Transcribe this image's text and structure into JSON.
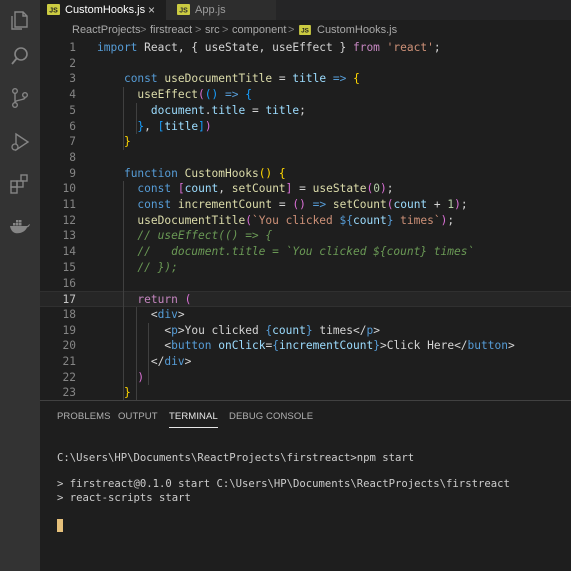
{
  "activity_bar": {
    "icons": [
      "explorer-icon",
      "search-icon",
      "source-control-icon",
      "run-debug-icon",
      "extensions-icon",
      "docker-icon"
    ]
  },
  "tabs": [
    {
      "label": "CustomHooks.js",
      "active": true,
      "icon": "js-file-icon",
      "close": "×"
    },
    {
      "label": "App.js",
      "active": false,
      "icon": "js-file-icon"
    }
  ],
  "breadcrumb": [
    "ReactProjects",
    "firstreact",
    "src",
    "component",
    "CustomHooks.js"
  ],
  "breadcrumb_separator": ">",
  "editor": {
    "current_line": 17,
    "lines": [
      {
        "n": "1",
        "tokens": [
          [
            "kw",
            "import"
          ],
          [
            "txt",
            " React, { useState, useEffect } "
          ],
          [
            "ctl",
            "from"
          ],
          [
            "txt",
            " "
          ],
          [
            "str",
            "'react'"
          ],
          [
            "txt",
            ";"
          ]
        ]
      },
      {
        "n": "2",
        "tokens": []
      },
      {
        "n": "3",
        "tokens": [
          [
            "txt",
            "    "
          ],
          [
            "kw",
            "const"
          ],
          [
            "txt",
            " "
          ],
          [
            "fn",
            "useDocumentTitle"
          ],
          [
            "txt",
            " = "
          ],
          [
            "var",
            "title"
          ],
          [
            "txt",
            " "
          ],
          [
            "kw",
            "=>"
          ],
          [
            "txt",
            " "
          ],
          [
            "b1",
            "{"
          ]
        ]
      },
      {
        "n": "4",
        "tokens": [
          [
            "txt",
            "      "
          ],
          [
            "fn",
            "useEffect"
          ],
          [
            "b2",
            "("
          ],
          [
            "b3",
            "()"
          ],
          [
            "txt",
            " "
          ],
          [
            "kw",
            "=>"
          ],
          [
            "txt",
            " "
          ],
          [
            "b3",
            "{"
          ]
        ]
      },
      {
        "n": "5",
        "tokens": [
          [
            "txt",
            "        "
          ],
          [
            "var",
            "document"
          ],
          [
            "txt",
            "."
          ],
          [
            "var",
            "title"
          ],
          [
            "txt",
            " = "
          ],
          [
            "var",
            "title"
          ],
          [
            "txt",
            ";"
          ]
        ]
      },
      {
        "n": "6",
        "tokens": [
          [
            "txt",
            "      "
          ],
          [
            "b3",
            "}"
          ],
          [
            "txt",
            ", "
          ],
          [
            "b3",
            "["
          ],
          [
            "var",
            "title"
          ],
          [
            "b3",
            "]"
          ],
          [
            "b2",
            ")"
          ]
        ]
      },
      {
        "n": "7",
        "tokens": [
          [
            "txt",
            "    "
          ],
          [
            "b1",
            "}"
          ]
        ]
      },
      {
        "n": "8",
        "tokens": []
      },
      {
        "n": "9",
        "tokens": [
          [
            "txt",
            "    "
          ],
          [
            "kw",
            "function"
          ],
          [
            "txt",
            " "
          ],
          [
            "fn",
            "CustomHooks"
          ],
          [
            "b1",
            "()"
          ],
          [
            "txt",
            " "
          ],
          [
            "b1",
            "{"
          ]
        ]
      },
      {
        "n": "10",
        "tokens": [
          [
            "txt",
            "      "
          ],
          [
            "kw",
            "const"
          ],
          [
            "txt",
            " "
          ],
          [
            "b2",
            "["
          ],
          [
            "var",
            "count"
          ],
          [
            "txt",
            ", "
          ],
          [
            "fn",
            "setCount"
          ],
          [
            "b2",
            "]"
          ],
          [
            "txt",
            " = "
          ],
          [
            "fn",
            "useState"
          ],
          [
            "b2",
            "("
          ],
          [
            "num",
            "0"
          ],
          [
            "b2",
            ")"
          ],
          [
            "txt",
            ";"
          ]
        ]
      },
      {
        "n": "11",
        "tokens": [
          [
            "txt",
            "      "
          ],
          [
            "kw",
            "const"
          ],
          [
            "txt",
            " "
          ],
          [
            "fn",
            "incrementCount"
          ],
          [
            "txt",
            " = "
          ],
          [
            "b2",
            "()"
          ],
          [
            "txt",
            " "
          ],
          [
            "kw",
            "=>"
          ],
          [
            "txt",
            " "
          ],
          [
            "fn",
            "setCount"
          ],
          [
            "b2",
            "("
          ],
          [
            "var",
            "count"
          ],
          [
            "txt",
            " + "
          ],
          [
            "num",
            "1"
          ],
          [
            "b2",
            ")"
          ],
          [
            "txt",
            ";"
          ]
        ]
      },
      {
        "n": "12",
        "tokens": [
          [
            "txt",
            "      "
          ],
          [
            "fn",
            "useDocumentTitle"
          ],
          [
            "b2",
            "("
          ],
          [
            "str",
            "`You clicked "
          ],
          [
            "kw",
            "${"
          ],
          [
            "var",
            "count"
          ],
          [
            "kw",
            "}"
          ],
          [
            "str",
            " times`"
          ],
          [
            "b2",
            ")"
          ],
          [
            "txt",
            ";"
          ]
        ]
      },
      {
        "n": "13",
        "tokens": [
          [
            "txt",
            "      "
          ],
          [
            "cmt",
            "// useEffect(() => {"
          ]
        ]
      },
      {
        "n": "14",
        "tokens": [
          [
            "txt",
            "      "
          ],
          [
            "cmt",
            "//   document.title = `You clicked ${count} times`"
          ]
        ]
      },
      {
        "n": "15",
        "tokens": [
          [
            "txt",
            "      "
          ],
          [
            "cmt",
            "// });"
          ]
        ]
      },
      {
        "n": "16",
        "tokens": []
      },
      {
        "n": "17",
        "tokens": [
          [
            "txt",
            "      "
          ],
          [
            "ctl",
            "return"
          ],
          [
            "txt",
            " "
          ],
          [
            "b2",
            "("
          ]
        ]
      },
      {
        "n": "18",
        "tokens": [
          [
            "txt",
            "        "
          ],
          [
            "txt",
            "<"
          ],
          [
            "tag",
            "div"
          ],
          [
            "txt",
            ">"
          ]
        ]
      },
      {
        "n": "19",
        "tokens": [
          [
            "txt",
            "          "
          ],
          [
            "txt",
            "<"
          ],
          [
            "tag",
            "p"
          ],
          [
            "txt",
            ">You clicked "
          ],
          [
            "kw",
            "{"
          ],
          [
            "var",
            "count"
          ],
          [
            "kw",
            "}"
          ],
          [
            "txt",
            " times</"
          ],
          [
            "tag",
            "p"
          ],
          [
            "txt",
            ">"
          ]
        ]
      },
      {
        "n": "20",
        "tokens": [
          [
            "txt",
            "          "
          ],
          [
            "txt",
            "<"
          ],
          [
            "tag",
            "button"
          ],
          [
            "txt",
            " "
          ],
          [
            "attr",
            "onClick"
          ],
          [
            "txt",
            "="
          ],
          [
            "kw",
            "{"
          ],
          [
            "var",
            "incrementCount"
          ],
          [
            "kw",
            "}"
          ],
          [
            "txt",
            ">Click Here</"
          ],
          [
            "tag",
            "button"
          ],
          [
            "txt",
            ">"
          ]
        ]
      },
      {
        "n": "21",
        "tokens": [
          [
            "txt",
            "        "
          ],
          [
            "txt",
            "</"
          ],
          [
            "tag",
            "div"
          ],
          [
            "txt",
            ">"
          ]
        ]
      },
      {
        "n": "22",
        "tokens": [
          [
            "txt",
            "      "
          ],
          [
            "b2",
            ")"
          ]
        ]
      },
      {
        "n": "23",
        "tokens": [
          [
            "txt",
            "    "
          ],
          [
            "b1",
            "}"
          ]
        ]
      }
    ]
  },
  "panel": {
    "tabs": [
      "PROBLEMS",
      "OUTPUT",
      "TERMINAL",
      "DEBUG CONSOLE"
    ],
    "active_tab": "TERMINAL",
    "terminal_lines": [
      "C:\\Users\\HP\\Documents\\ReactProjects\\firstreact>npm start",
      "> firstreact@0.1.0 start C:\\Users\\HP\\Documents\\ReactProjects\\firstreact",
      "> react-scripts start"
    ]
  },
  "colors": {
    "activity_bar": "#333333",
    "editor_bg": "#1e1e1e",
    "keyword": "#569cd6",
    "function": "#dcdcaa",
    "string": "#ce9178",
    "comment": "#6a9955",
    "terminal_cursor": "#e5c07b"
  }
}
